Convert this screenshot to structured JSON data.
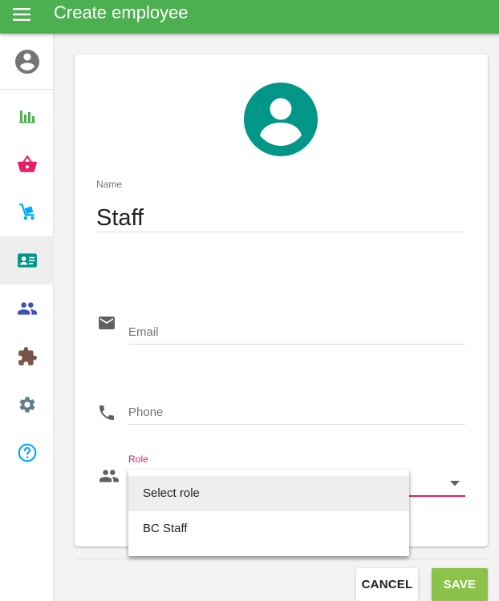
{
  "app": {
    "title": "Create employee",
    "accent_color": "#4caf50",
    "menu_icon": "menu-icon"
  },
  "sidebar": {
    "avatar_icon": "account-circle-icon",
    "items": [
      {
        "name": "reports",
        "icon": "bar-chart-icon",
        "color": "#4caf50"
      },
      {
        "name": "sales",
        "icon": "basket-icon",
        "color": "#e91e63"
      },
      {
        "name": "inventory",
        "icon": "hand-truck-icon",
        "color": "#03a9f4"
      },
      {
        "name": "employees",
        "icon": "contact-card-icon",
        "color": "#009688",
        "active": true
      },
      {
        "name": "customers",
        "icon": "people-icon",
        "color": "#3f51b5"
      },
      {
        "name": "addons",
        "icon": "puzzle-icon",
        "color": "#795548"
      },
      {
        "name": "settings",
        "icon": "gear-icon",
        "color": "#607d8b"
      },
      {
        "name": "help",
        "icon": "help-circle-icon",
        "color": "#03a9f4"
      }
    ]
  },
  "form": {
    "avatar_icon": "account-circle-icon",
    "avatar_color": "#009688",
    "name_label": "Name",
    "name_value": "Staff",
    "email_placeholder": "Email",
    "email_value": "",
    "phone_placeholder": "Phone",
    "phone_value": "",
    "role_label": "Role",
    "role_value": "",
    "role_options": [
      "Select role",
      "BC Staff"
    ],
    "role_highlighted": "Select role",
    "error_color": "#e91e63"
  },
  "actions": {
    "cancel_label": "CANCEL",
    "save_label": "SAVE",
    "save_color": "#8bc34a"
  }
}
